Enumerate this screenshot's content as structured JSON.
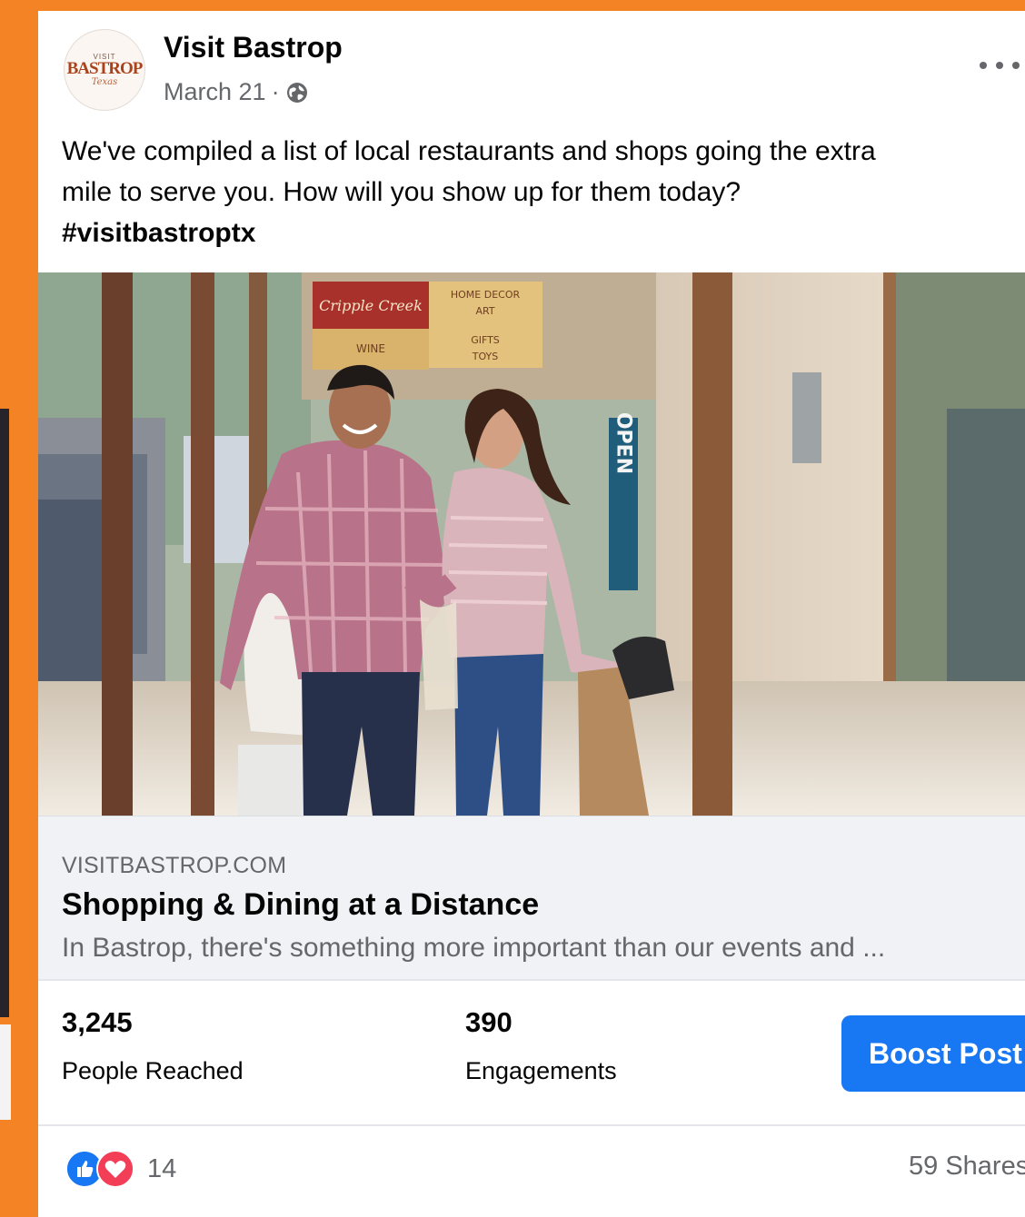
{
  "post": {
    "page_name": "Visit Bastrop",
    "date": "March 21",
    "date_separator": "·",
    "avatar_small_text": "VISIT",
    "avatar_brand_text": "BASTROP",
    "avatar_script_text": "Texas",
    "text_line1": "We've compiled a list of local restaurants and shops going the extra",
    "text_line2": "mile to serve you. How will you show up for them today?",
    "hashtag": "#visitbastroptx"
  },
  "photo": {
    "sign_main": "Cripple Creek",
    "sign_home": "HOME DECOR",
    "sign_art": "ART",
    "sign_wine": "WINE",
    "sign_gifts": "GIFTS",
    "sign_toys": "TOYS",
    "open_sign": "OPEN"
  },
  "link_preview": {
    "domain": "VISITBASTROP.COM",
    "title": "Shopping & Dining at a Distance",
    "description": "In Bastrop, there's something more important than our events and ..."
  },
  "insights": {
    "reach_value": "3,245",
    "reach_label": "People Reached",
    "engagement_value": "390",
    "engagement_label": "Engagements",
    "boost_label": "Boost Post"
  },
  "footer": {
    "reaction_count": "14",
    "shares": "59 Shares"
  },
  "colors": {
    "background": "#f38325",
    "boost_button": "#1877f2",
    "like": "#1877f2",
    "love": "#f33e58"
  },
  "icons": [
    "globe-icon",
    "more-options-icon",
    "like-reaction-icon",
    "love-reaction-icon"
  ]
}
